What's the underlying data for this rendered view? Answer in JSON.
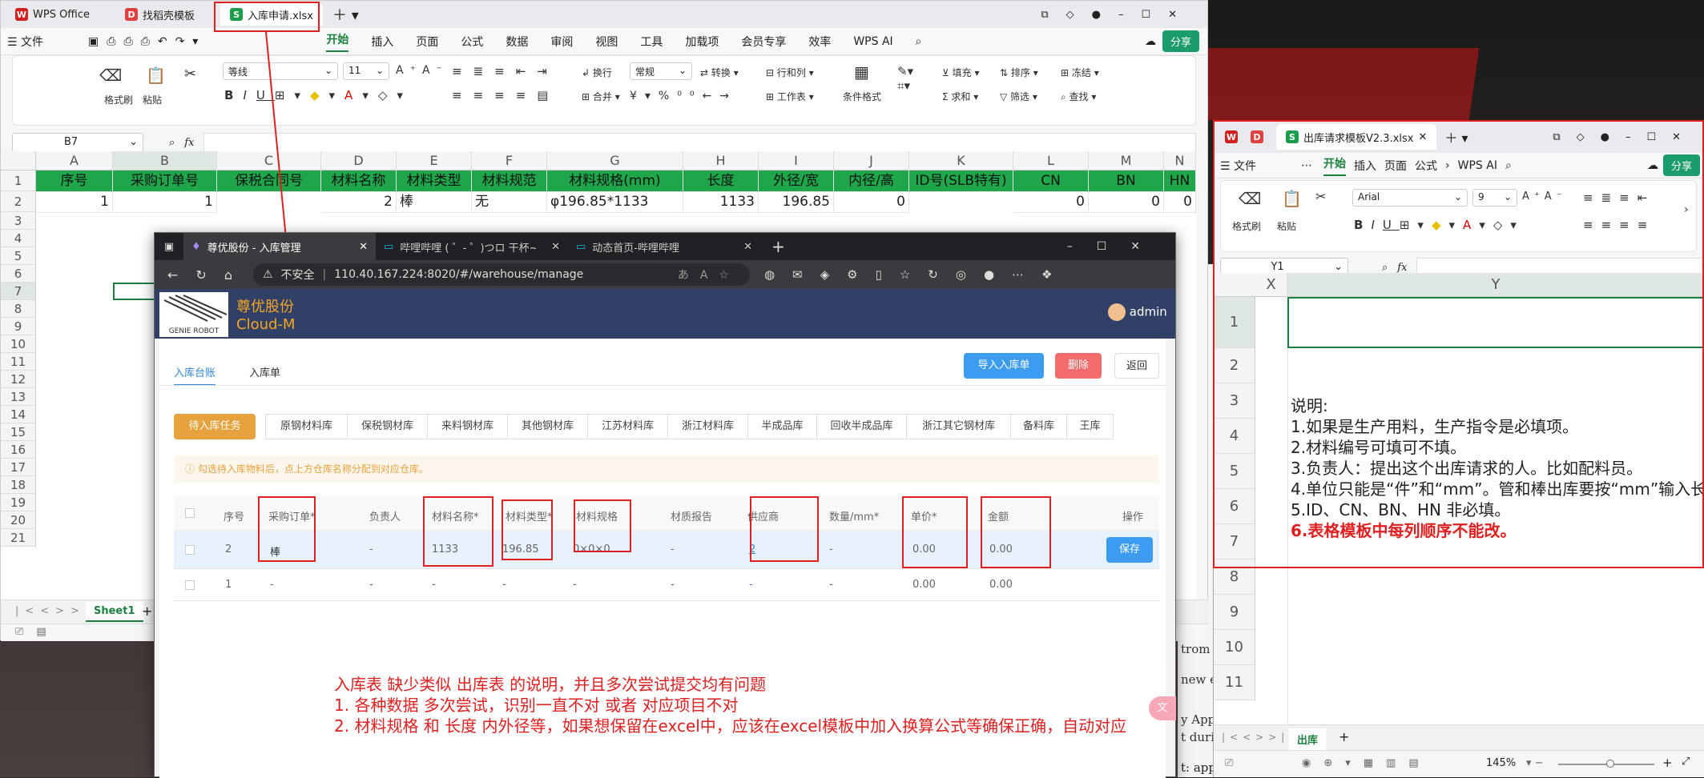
{
  "wps_main": {
    "tabs": [
      "WPS Office",
      "找稻壳模板",
      "入库申请.xlsx"
    ],
    "menus": [
      "文件",
      "开始",
      "插入",
      "页面",
      "公式",
      "数据",
      "审阅",
      "视图",
      "工具",
      "加载项",
      "会员专享",
      "效率",
      "WPS AI"
    ],
    "share": "分享",
    "ribbon": {
      "format_painter": "格式刷",
      "paste": "粘贴",
      "font_name": "等线",
      "font_size": "11",
      "wrap": "换行",
      "merge": "合并",
      "number_format": "常规",
      "convert": "转换",
      "row_col": "行和列",
      "worksheet": "工作表",
      "cond_format": "条件格式",
      "fill": "填充",
      "sort": "排序",
      "freeze": "冻结",
      "sum": "求和",
      "filter": "筛选",
      "find": "查找"
    },
    "name_box": "B7",
    "fx": "fx",
    "columns": [
      "A",
      "B",
      "C",
      "D",
      "E",
      "F",
      "G",
      "H",
      "I",
      "J",
      "K",
      "L",
      "M",
      "N"
    ],
    "header_row": [
      "序号",
      "采购订单号",
      "保税合同号",
      "材料名称",
      "材料类型",
      "材料规范",
      "材料规格(mm)",
      "长度",
      "外径/宽",
      "内径/高",
      "ID号(SLB特有)",
      "CN",
      "BN",
      "HN"
    ],
    "data_row": [
      "1",
      "1",
      "",
      "2",
      "棒",
      "无",
      "φ196.85*1133",
      "1133",
      "196.85",
      "0",
      "",
      "0",
      "0",
      "0"
    ],
    "rows": [
      "1",
      "2",
      "3",
      "4",
      "5",
      "6",
      "7",
      "8",
      "9",
      "10",
      "11",
      "12",
      "13",
      "14",
      "15",
      "16",
      "17",
      "18",
      "19",
      "20",
      "21"
    ],
    "sheet": "Sheet1"
  },
  "browser": {
    "tabs": [
      "尊优股份 - 入库管理",
      "哔哩哔哩 ( ゜- ゜)つロ 干杯~-bilib",
      "动态首页-哔哩哔哩"
    ],
    "insecure": "不安全",
    "url": "110.40.167.224:8020/#/warehouse/manage",
    "brand": "尊优股份",
    "brand_sub": "Cloud-M",
    "logo_text": "GENIE ROBOT",
    "user": "admin",
    "subtabs": [
      "入库台账",
      "入库单"
    ],
    "buttons": {
      "import": "导入入库单",
      "delete": "删除",
      "back": "返回"
    },
    "task_btn": "待入库任务",
    "categories": [
      "原钢材料库",
      "保税钢材库",
      "来料钢材库",
      "其他钢材库",
      "江苏材料库",
      "浙江材料库",
      "半成品库",
      "回收半成品库",
      "浙江其它钢材库",
      "备料库",
      "王库"
    ],
    "tip": "勾选待入库物料后，点上方仓库名称分配到对应仓库。",
    "table_headers": [
      "序号",
      "采购订单*",
      "负责人",
      "材料名称*",
      "材料类型*",
      "材料规格",
      "材质报告",
      "供应商",
      "数量/mm*",
      "单价*",
      "金额",
      "操作"
    ],
    "row1": [
      "2",
      "棒",
      "-",
      "1133",
      "196.85",
      "0×0×0",
      "-",
      "2",
      "-",
      "0.00",
      "0.00",
      "保存"
    ],
    "row2": [
      "1",
      "-",
      "-",
      "-",
      "-",
      "-",
      "-",
      "-",
      "-",
      "0.00",
      "0.00"
    ],
    "notes": [
      "入库表 缺少类似 出库表 的说明，并且多次尝试提交均有问题",
      "1. 各种数据 多次尝试，识别一直不对 或者 对应项目不对",
      "2. 材料规格 和 长度 内外径等，如果想保留在excel中，应该在excel模板中加入换算公式等确保正确，自动对应"
    ]
  },
  "wps_right": {
    "tab": "出库请求模板V2.3.xlsx",
    "menus": [
      "文件",
      "开始",
      "插入",
      "页面",
      "公式",
      "WPS AI"
    ],
    "share": "分享",
    "font": "Arial",
    "size": "9",
    "format_painter": "格式刷",
    "paste": "粘贴",
    "name_box": "Y1",
    "fx": "fx",
    "columns": [
      "X",
      "Y"
    ],
    "rows": [
      "1",
      "2",
      "3",
      "4",
      "5",
      "6",
      "7",
      "8",
      "9",
      "10",
      "11"
    ],
    "instructions": [
      "说明:",
      "1.如果是生产用料，生产指令是必填项。",
      "2.材料编号可填可不填。",
      "3.负责人：提出这个出库请求的人。比如配料员。",
      "4.单位只能是“件”和“mm”。管和棒出库要按“mm”输入长",
      "5.ID、CN、BN、HN 非必填。",
      "6.表格模板中每列顺序不能改。"
    ],
    "sheet": "出库",
    "zoom": "145%"
  },
  "bg_text": [
    "trom n",
    "new el",
    "y Appe",
    "t during",
    "t: append entry to local log,"
  ]
}
